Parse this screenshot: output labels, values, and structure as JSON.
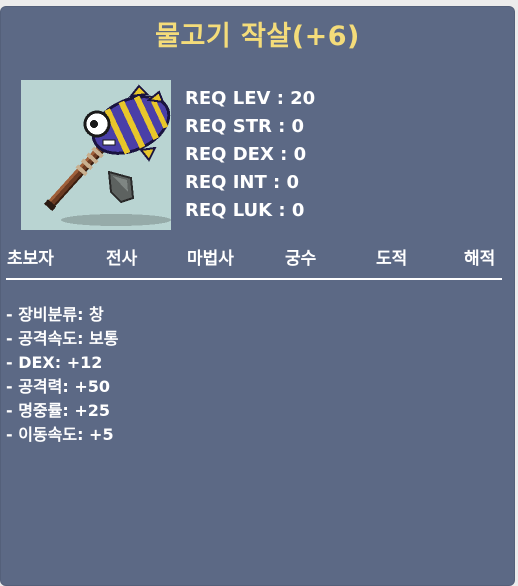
{
  "item": {
    "name": "물고기 작살(+6)",
    "image_icon": "fish-harpoon-icon",
    "name_color": "#f4dc7a"
  },
  "requirements": [
    "REQ LEV : 20",
    "REQ STR : 0",
    "REQ DEX : 0",
    "REQ INT : 0",
    "REQ LUK : 0"
  ],
  "jobs": [
    "초보자",
    "전사",
    "마법사",
    "궁수",
    "도적",
    "해적"
  ],
  "stats": [
    "- 장비분류: 창",
    "- 공격속도: 보통",
    "- DEX: +12",
    "- 공격력: +50",
    "- 명중률: +25",
    "- 이동속도: +5"
  ]
}
